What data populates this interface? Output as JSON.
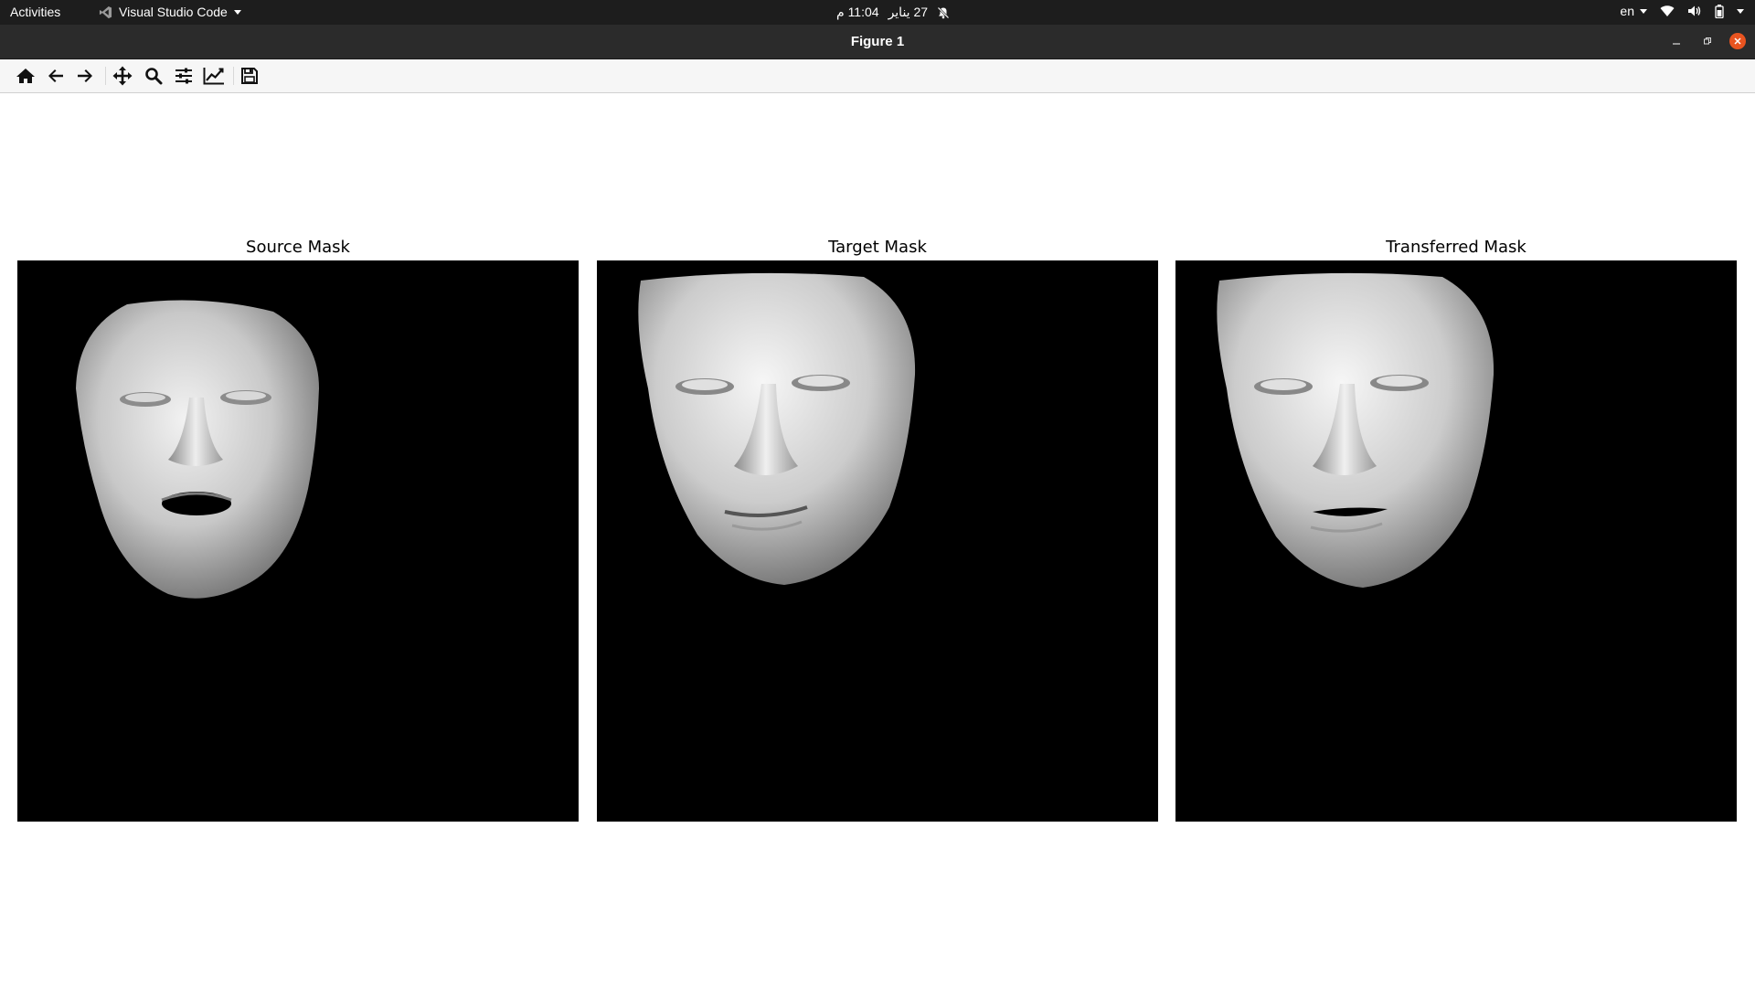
{
  "topbar": {
    "activities": "Activities",
    "app_name": "Visual Studio Code",
    "clock": "11:04 ﻡ ‏27 ﻲﻨﻳ",
    "clock_date": "27 يناير",
    "clock_time": "11:04 م",
    "keyboard_layout": "en",
    "icons": [
      "wifi-icon",
      "volume-icon",
      "battery-icon",
      "system-menu-icon"
    ]
  },
  "window": {
    "title": "Figure 1",
    "controls": [
      "minimize-icon",
      "restore-icon",
      "close-icon"
    ],
    "close_color": "#e95420"
  },
  "toolbar": {
    "buttons": [
      "home-icon",
      "back-icon",
      "forward-icon",
      "pan-icon",
      "zoom-icon",
      "configure-subplots-icon",
      "edit-axis-icon",
      "save-icon"
    ]
  },
  "figure": {
    "background": "#000000",
    "panels": [
      {
        "title": "Source Mask",
        "image": "face-render-open-mouth"
      },
      {
        "title": "Target Mask",
        "image": "face-render-closed-mouth"
      },
      {
        "title": "Transferred Mask",
        "image": "face-render-transferred"
      }
    ]
  }
}
